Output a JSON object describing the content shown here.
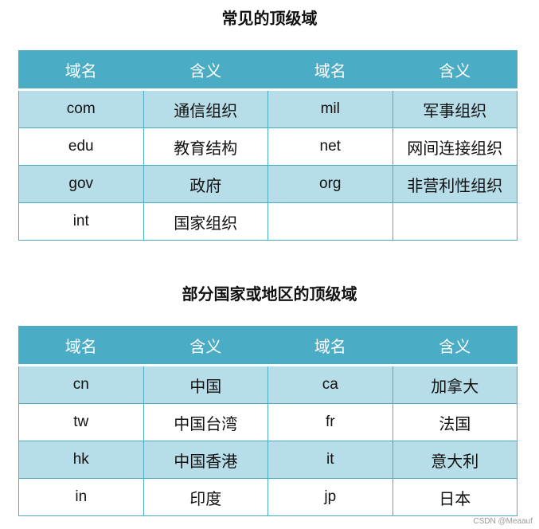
{
  "section1": {
    "title": "常见的顶级域",
    "headers": [
      "域名",
      "含义",
      "域名",
      "含义"
    ],
    "rows": [
      [
        "com",
        "通信组织",
        "mil",
        "军事组织"
      ],
      [
        "edu",
        "教育结构",
        "net",
        "网间连接组织"
      ],
      [
        "gov",
        "政府",
        "org",
        "非营利性组织"
      ],
      [
        "int",
        "国家组织",
        "",
        ""
      ]
    ]
  },
  "section2": {
    "title": "部分国家或地区的顶级域",
    "headers": [
      "域名",
      "含义",
      "域名",
      "含义"
    ],
    "rows": [
      [
        "cn",
        "中国",
        "ca",
        "加拿大"
      ],
      [
        "tw",
        "中国台湾",
        "fr",
        "法国"
      ],
      [
        "hk",
        "中国香港",
        "it",
        "意大利"
      ],
      [
        "in",
        "印度",
        "jp",
        "日本"
      ]
    ]
  },
  "watermark": "CSDN @Meaauf"
}
